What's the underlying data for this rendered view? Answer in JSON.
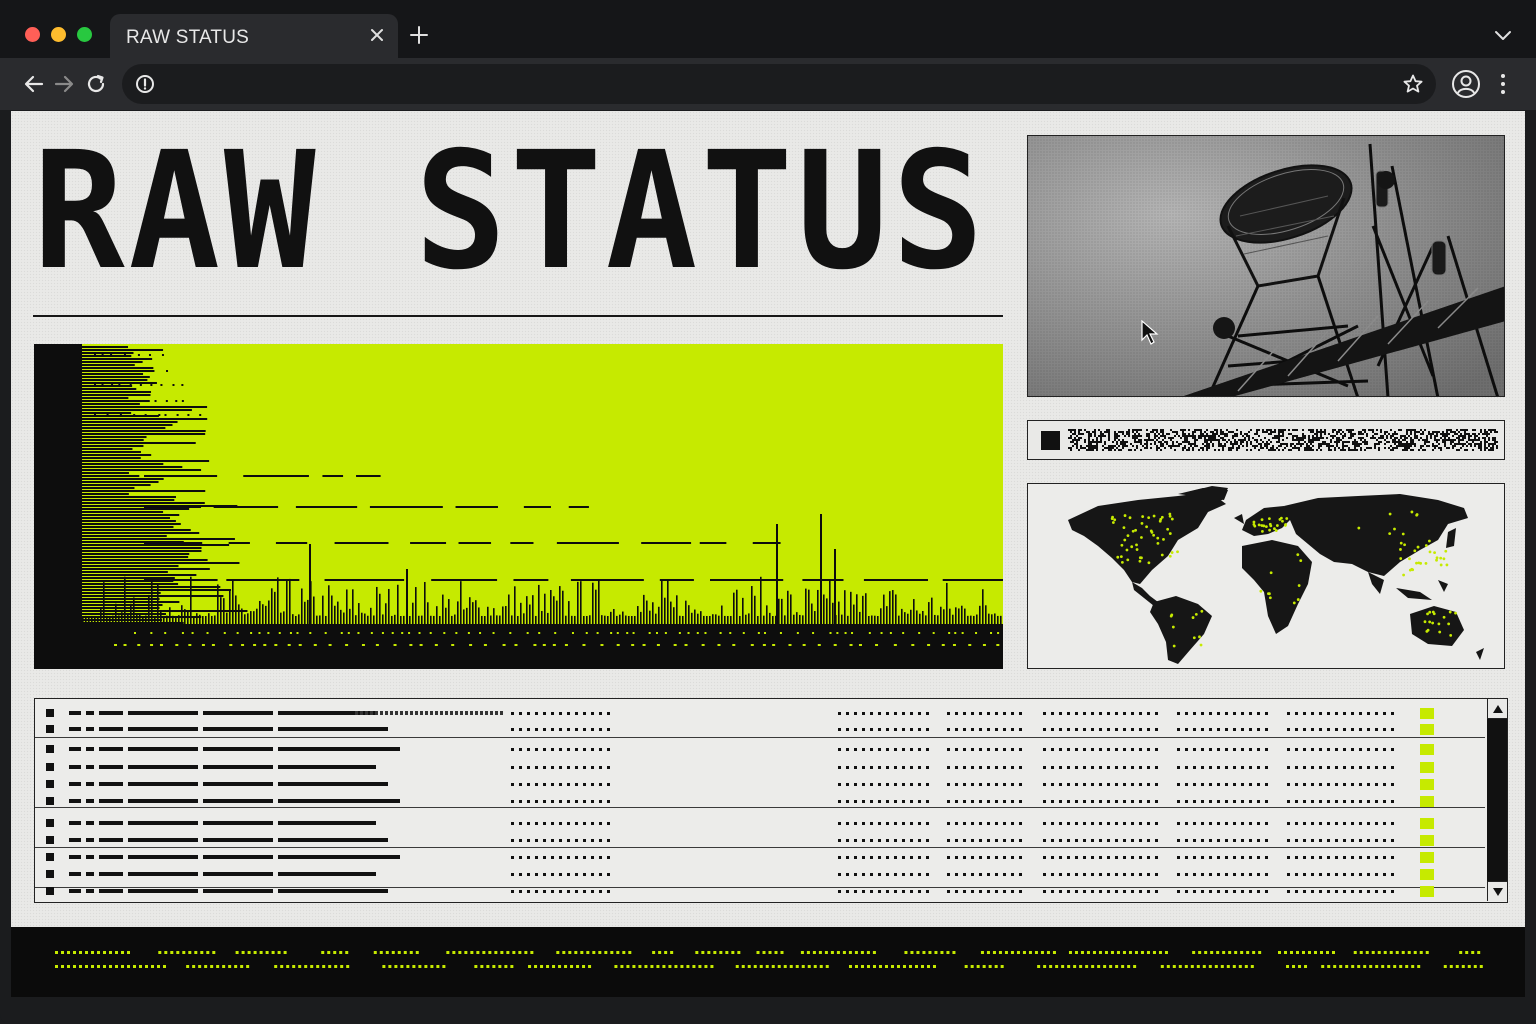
{
  "browser": {
    "tab_title": "RAW STATUS",
    "url": "",
    "icons": {
      "back": "arrow-left-icon",
      "forward": "arrow-right-icon",
      "reload": "reload-icon",
      "site_info": "info-icon",
      "bookmark": "star-icon",
      "profile": "profile-icon",
      "menu": "kebab-menu-icon",
      "close_tab": "close-icon",
      "new_tab": "plus-icon",
      "tab_list": "chevron-down-icon"
    },
    "colors": {
      "tabstrip": "#151618",
      "active_tab": "#2a2b2e",
      "close": "#ff5f57",
      "minimize": "#febc2e",
      "maximize": "#28c840"
    }
  },
  "page": {
    "headline": "RAW STATUS",
    "accent_color": "#c6ea00",
    "ink_color": "#111111",
    "paper_color": "#e9e9e7",
    "panels": {
      "spectrogram": "signal spectrogram",
      "photo": "radio telescope tower photo",
      "status": "encoded status strip",
      "map": "world map with node points"
    },
    "table": {
      "rows": 11,
      "status_color": "#c6ea00"
    },
    "footer_ticker_color": "#c6ea00"
  }
}
